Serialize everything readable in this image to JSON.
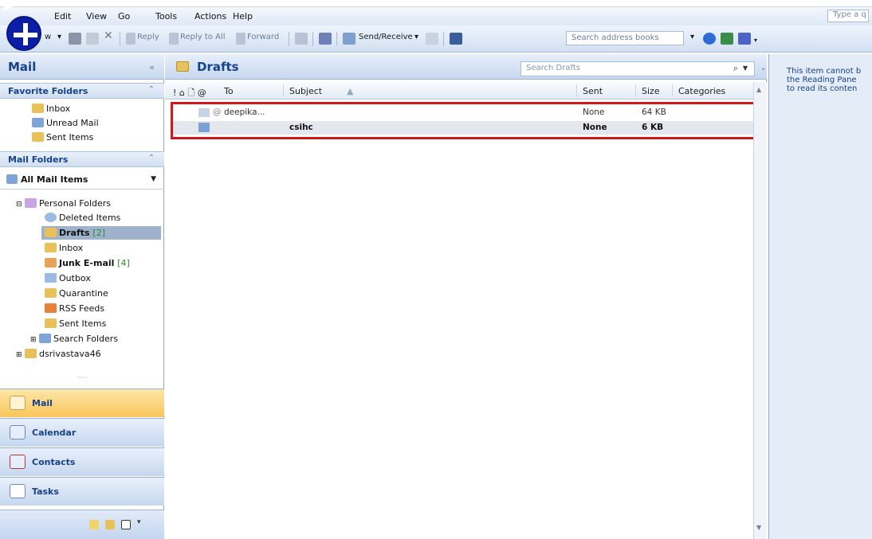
{
  "menu": {
    "items": [
      "Edit",
      "View",
      "Go",
      "Tools",
      "Actions",
      "Help"
    ],
    "ask_box": "Type a q"
  },
  "toolbar": {
    "new_label": "w",
    "reply": "Reply",
    "reply_all": "Reply to All",
    "forward": "Forward",
    "send_receive": "Send/Receive",
    "search_address_books": "Search address books"
  },
  "navigation": {
    "title": "Mail",
    "collapse": "«",
    "favorite_folders": {
      "header": "Favorite Folders",
      "items": [
        "Inbox",
        "Unread Mail",
        "Sent Items"
      ]
    },
    "mail_folders": {
      "header": "Mail Folders",
      "view_selector": "All Mail Items",
      "tree": [
        {
          "label": "Personal Folders",
          "count": ""
        },
        {
          "label": "Deleted Items",
          "count": ""
        },
        {
          "label": "Drafts",
          "count": "[2]"
        },
        {
          "label": "Inbox",
          "count": ""
        },
        {
          "label": "Junk E-mail",
          "count": "[4]"
        },
        {
          "label": "Outbox",
          "count": ""
        },
        {
          "label": "Quarantine",
          "count": ""
        },
        {
          "label": "RSS Feeds",
          "count": ""
        },
        {
          "label": "Sent Items",
          "count": ""
        },
        {
          "label": "Search Folders",
          "count": ""
        },
        {
          "label": "dsrivastava46",
          "count": ""
        }
      ]
    },
    "buttons": [
      "Mail",
      "Calendar",
      "Contacts",
      "Tasks"
    ]
  },
  "list": {
    "folder_title": "Drafts",
    "search_placeholder": "Search Drafts",
    "columns": {
      "icons": "! ⌂ 🗋 @",
      "to": "To",
      "subject": "Subject",
      "sent": "Sent",
      "size": "Size",
      "categories": "Categories"
    },
    "rows": [
      {
        "to": "deepika...",
        "subject": "",
        "sent": "None",
        "size": "64 KB",
        "categories": ""
      },
      {
        "to": "",
        "subject": "csihc",
        "sent": "None",
        "size": "6 KB",
        "categories": ""
      }
    ]
  },
  "reading_pane": {
    "line1": "This item cannot b",
    "line2": "the Reading Pane",
    "line3": "to read its conten"
  },
  "colors": {
    "accent": "#15428b",
    "highlight_box": "#d01818",
    "active_nav": "#f9c55a",
    "count": "#2c8a2c"
  }
}
